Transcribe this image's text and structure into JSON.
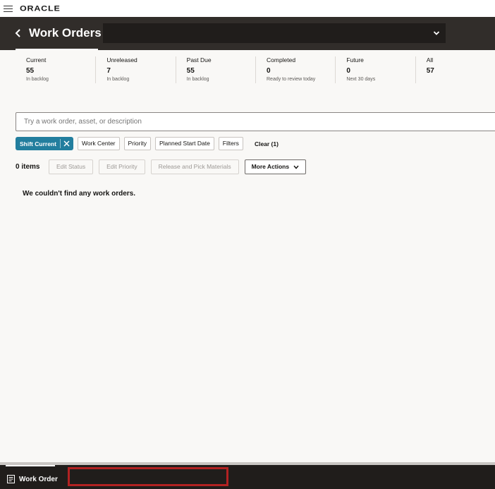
{
  "brand": {
    "logo_text": "ORACLE"
  },
  "header": {
    "title": "Work Orders",
    "context_value": ""
  },
  "summary": [
    {
      "label": "Current",
      "count": "55",
      "sub": "In backlog"
    },
    {
      "label": "Unreleased",
      "count": "7",
      "sub": "In backlog"
    },
    {
      "label": "Past Due",
      "count": "55",
      "sub": "In backlog"
    },
    {
      "label": "Completed",
      "count": "0",
      "sub": "Ready to review today"
    },
    {
      "label": "Future",
      "count": "0",
      "sub": "Next 30 days"
    },
    {
      "label": "All",
      "count": "57",
      "sub": ""
    }
  ],
  "search": {
    "placeholder": "Try a work order, asset, or description",
    "value": ""
  },
  "filters": {
    "active_chip": "Shift Current",
    "chips": [
      "Work Center",
      "Priority",
      "Planned Start Date",
      "Filters"
    ],
    "clear_label": "Clear (1)"
  },
  "actions": {
    "count_label": "0 items",
    "edit_status": "Edit Status",
    "edit_priority": "Edit Priority",
    "release": "Release and Pick Materials",
    "more": "More Actions"
  },
  "empty_message": "We couldn't find any work orders.",
  "footer": {
    "tab_label": "Work Order"
  },
  "colors": {
    "header_bg": "#312d2a",
    "accent": "#227e9e",
    "footer_bg": "#201d1b",
    "highlight": "#b22222"
  }
}
